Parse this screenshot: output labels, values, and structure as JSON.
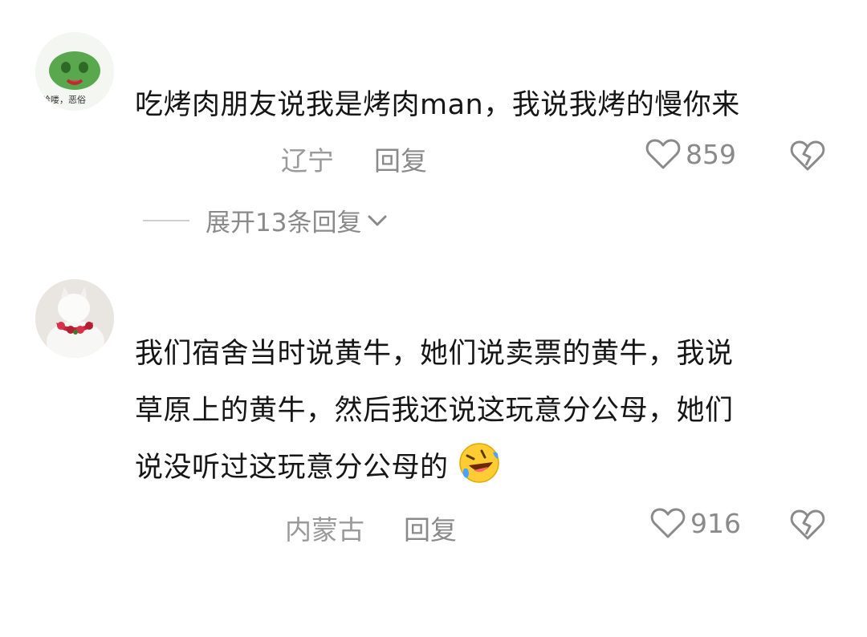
{
  "comments": [
    {
      "text": "吃烤肉朋友说我是烤肉man，我说我烤的慢你来",
      "location": "辽宁",
      "reply_label": "回复",
      "likes": "859",
      "avatar_caption": "哈喽，恶俗"
    },
    {
      "text_lines": [
        "我们宿舍当时说黄牛，她们说卖票的黄牛，我说",
        "草原上的黄牛，然后我还说这玩意分公母，她们",
        "说没听过这玩意分公母的"
      ],
      "location": "内蒙古",
      "reply_label": "回复",
      "likes": "916",
      "emoji": "rolling-laughing-emoji"
    }
  ],
  "expand_replies": "展开13条回复",
  "colors": {
    "meta_gray": "#8a8a8a",
    "text": "#161616",
    "divider": "#d0d0d0"
  }
}
